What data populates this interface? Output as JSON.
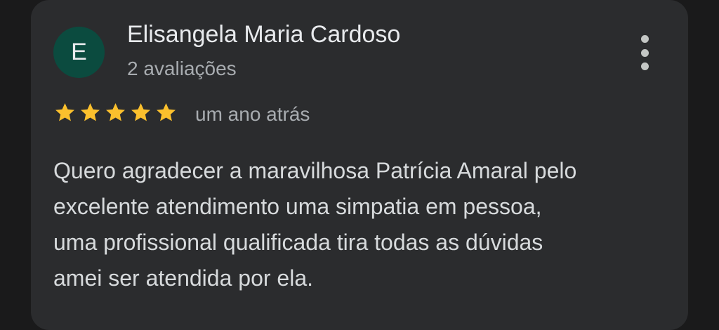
{
  "review": {
    "author_initial": "E",
    "author_name": "Elisangela Maria Cardoso",
    "author_review_count": "2 avaliações",
    "rating": 5,
    "rating_max": 5,
    "date": "um ano atrás",
    "text": "Quero agradecer a maravilhosa Patrícia Amaral pelo\nexcelente atendimento uma simpatia em pessoa,\numa profissional qualificada tira todas as dúvidas\namei ser atendida por ela."
  },
  "icons": {
    "more": "more-vert-icon",
    "star": "star-icon"
  },
  "colors": {
    "background": "#1a1a1b",
    "card": "#2b2c2e",
    "avatar": "#0b4b3f",
    "star": "#fbc02d",
    "primary_text": "#e8eaed",
    "secondary_text": "#a8acb0"
  }
}
